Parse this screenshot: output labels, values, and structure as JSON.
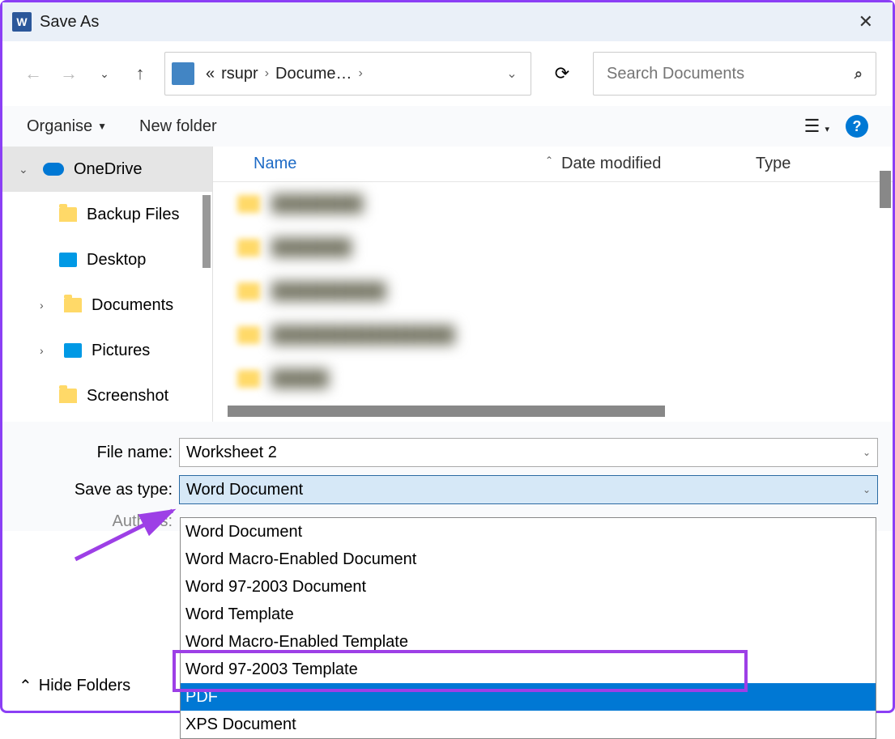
{
  "title": "Save As",
  "breadcrumb": {
    "root_marker": "«",
    "seg1": "rsupr",
    "seg2": "Docume…"
  },
  "search": {
    "placeholder": "Search Documents"
  },
  "toolbar": {
    "organise": "Organise",
    "newfolder": "New folder"
  },
  "sidebar": {
    "items": [
      {
        "label": "OneDrive"
      },
      {
        "label": "Backup Files"
      },
      {
        "label": "Desktop"
      },
      {
        "label": "Documents"
      },
      {
        "label": "Pictures"
      },
      {
        "label": "Screenshot"
      }
    ]
  },
  "columns": {
    "name": "Name",
    "date": "Date modified",
    "type": "Type"
  },
  "form": {
    "filename_label": "File name:",
    "filename_value": "Worksheet 2",
    "type_label": "Save as type:",
    "type_value": "Word Document",
    "authors_label": "Authors:"
  },
  "type_options": [
    "Word Document",
    "Word Macro-Enabled Document",
    "Word 97-2003 Document",
    "Word Template",
    "Word Macro-Enabled Template",
    "Word 97-2003 Template",
    "PDF",
    "XPS Document"
  ],
  "hide_folders": "Hide Folders"
}
